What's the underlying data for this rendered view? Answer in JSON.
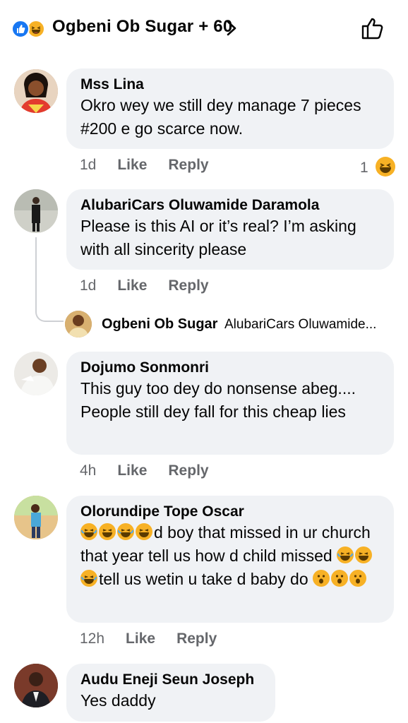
{
  "header": {
    "title": "Ogbeni Ob Sugar + 60",
    "icons": [
      "like-reaction-icon",
      "haha-reaction-icon",
      "chevron-right-icon",
      "thumbs-up-icon"
    ],
    "colors": {
      "like_blue": "#1877f2",
      "haha_yellow": "#f7b125"
    }
  },
  "comments": [
    {
      "name": "Mss Lina",
      "text": "Okro wey we still dey manage 7 pieces #200 e go scarce now.",
      "time": "1d",
      "like": "Like",
      "reply": "Reply",
      "reaction_count": "1"
    },
    {
      "name": "AlubariCars Oluwamide Daramola",
      "text": "Please is this AI or it’s real? I’m asking with all sincerity please",
      "time": "1d",
      "like": "Like",
      "reply": "Reply"
    },
    {
      "name": "Dojumo Sonmonri",
      "text": "This guy too dey do nonsense abeg.... People still dey fall for this cheap lies",
      "time": "4h",
      "like": "Like",
      "reply": "Reply"
    },
    {
      "name": "Olorundipe Tope Oscar",
      "text_part1": "d boy that missed in ur church that year tell us how d child missed",
      "text_part2": "tell us wetin u take d baby do",
      "time": "12h",
      "like": "Like",
      "reply": "Reply"
    },
    {
      "name": "Audu Eneji Seun Joseph",
      "text": "Yes daddy"
    }
  ],
  "reply_preview": {
    "name": "Ogbeni Ob Sugar",
    "text": "AlubariCars Oluwamide..."
  }
}
